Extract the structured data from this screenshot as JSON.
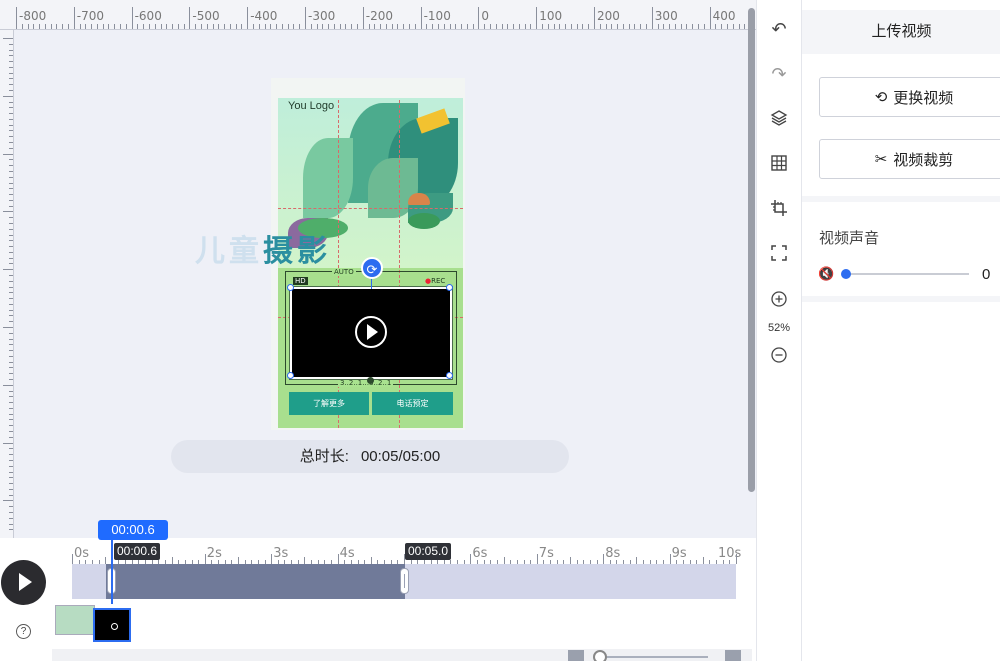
{
  "ruler": {
    "top_labels": [
      "-800",
      "-700",
      "-600",
      "-500",
      "-400",
      "-300",
      "-200",
      "-100",
      "0",
      "100",
      "200",
      "300",
      "400"
    ]
  },
  "poster": {
    "logo_text": "You Logo",
    "cam_auto": "AUTO",
    "cam_hd": "HD",
    "cam_rec": "REC",
    "cam_bottom": "3..2..1..:3..2..1",
    "btn_left": "了解更多",
    "btn_right": "电话预定"
  },
  "watermark": {
    "light": "儿童",
    "dark": "摄影"
  },
  "duration": {
    "label": "总时长:",
    "value": "00:05/05:00"
  },
  "toolbar": {
    "zoom_level": "52%",
    "icons": [
      "undo-icon",
      "redo-icon",
      "layers-icon",
      "grid-icon",
      "crop-icon",
      "fullscreen-icon",
      "zoom-in-icon",
      "zoom-out-icon"
    ]
  },
  "panel": {
    "title": "上传视频",
    "replace_label": "更换视频",
    "trim_label": "视频裁剪",
    "sound_label": "视频声音",
    "volume_value": "0"
  },
  "timeline": {
    "playhead_time": "00:00.6",
    "start_chip": "00:00.6",
    "end_chip": "00:05.0",
    "ticks": [
      "0s",
      "1s",
      "2s",
      "3s",
      "4s",
      "5s",
      "6s",
      "7s",
      "8s",
      "9s",
      "10s"
    ],
    "selection_start_s": 0.6,
    "selection_end_s": 5.0,
    "total_s": 10
  },
  "colors": {
    "accent": "#1f6bff",
    "poster_button": "#1f9e8a",
    "selection": "#707a99",
    "track": "#d3d6ea"
  }
}
